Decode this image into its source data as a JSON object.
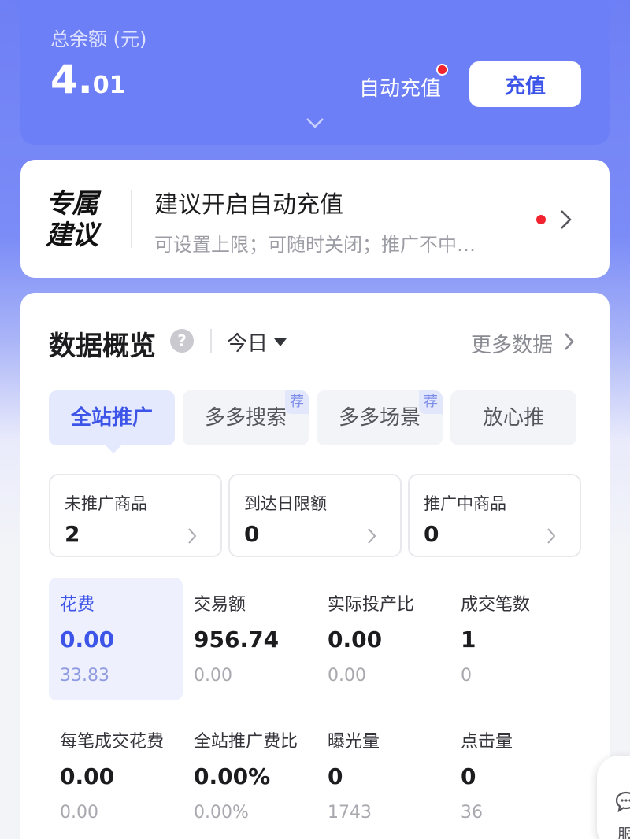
{
  "balance": {
    "label": "总余额 (元)",
    "value_int": "4.",
    "value_dec": "01",
    "auto_recharge": "自动充值",
    "recharge_button": "充值",
    "expand_icon": "chevron-down-icon"
  },
  "suggestion": {
    "badge_line1": "专属",
    "badge_line2": "建议",
    "title": "建议开启自动充值",
    "subtitle": "可设置上限；可随时关闭；推广不中…",
    "has_notice_dot": true
  },
  "overview": {
    "title": "数据概览",
    "help_icon": "?",
    "period": "今日",
    "more": "更多数据",
    "tabs": [
      {
        "label": "全站推广",
        "badge": "",
        "active": true
      },
      {
        "label": "多多搜索",
        "badge": "荐",
        "active": false
      },
      {
        "label": "多多场景",
        "badge": "荐",
        "active": false
      },
      {
        "label": "放心推",
        "badge": "",
        "active": false
      }
    ],
    "mini_cards": [
      {
        "label": "未推广商品",
        "value": "2"
      },
      {
        "label": "到达日限额",
        "value": "0"
      },
      {
        "label": "推广中商品",
        "value": "0"
      }
    ],
    "metrics": [
      {
        "label": "花费",
        "value": "0.00",
        "sub": "33.83",
        "active": true
      },
      {
        "label": "交易额",
        "value": "956.74",
        "sub": "0.00"
      },
      {
        "label": "实际投产比",
        "value": "0.00",
        "sub": "0.00"
      },
      {
        "label": "成交笔数",
        "value": "1",
        "sub": "0"
      },
      {
        "label": "每笔成交花费",
        "value": "0.00",
        "sub": "0.00"
      },
      {
        "label": "全站推广费比",
        "value": "0.00%",
        "sub": "0.00%"
      },
      {
        "label": "曝光量",
        "value": "0",
        "sub": "1743"
      },
      {
        "label": "点击量",
        "value": "0",
        "sub": "36"
      }
    ]
  },
  "service": {
    "icon": "chat-icon",
    "label": "服"
  },
  "colors": {
    "brand": "#6d7ff6",
    "accent": "#3d54e8",
    "notice": "#f2232e"
  }
}
